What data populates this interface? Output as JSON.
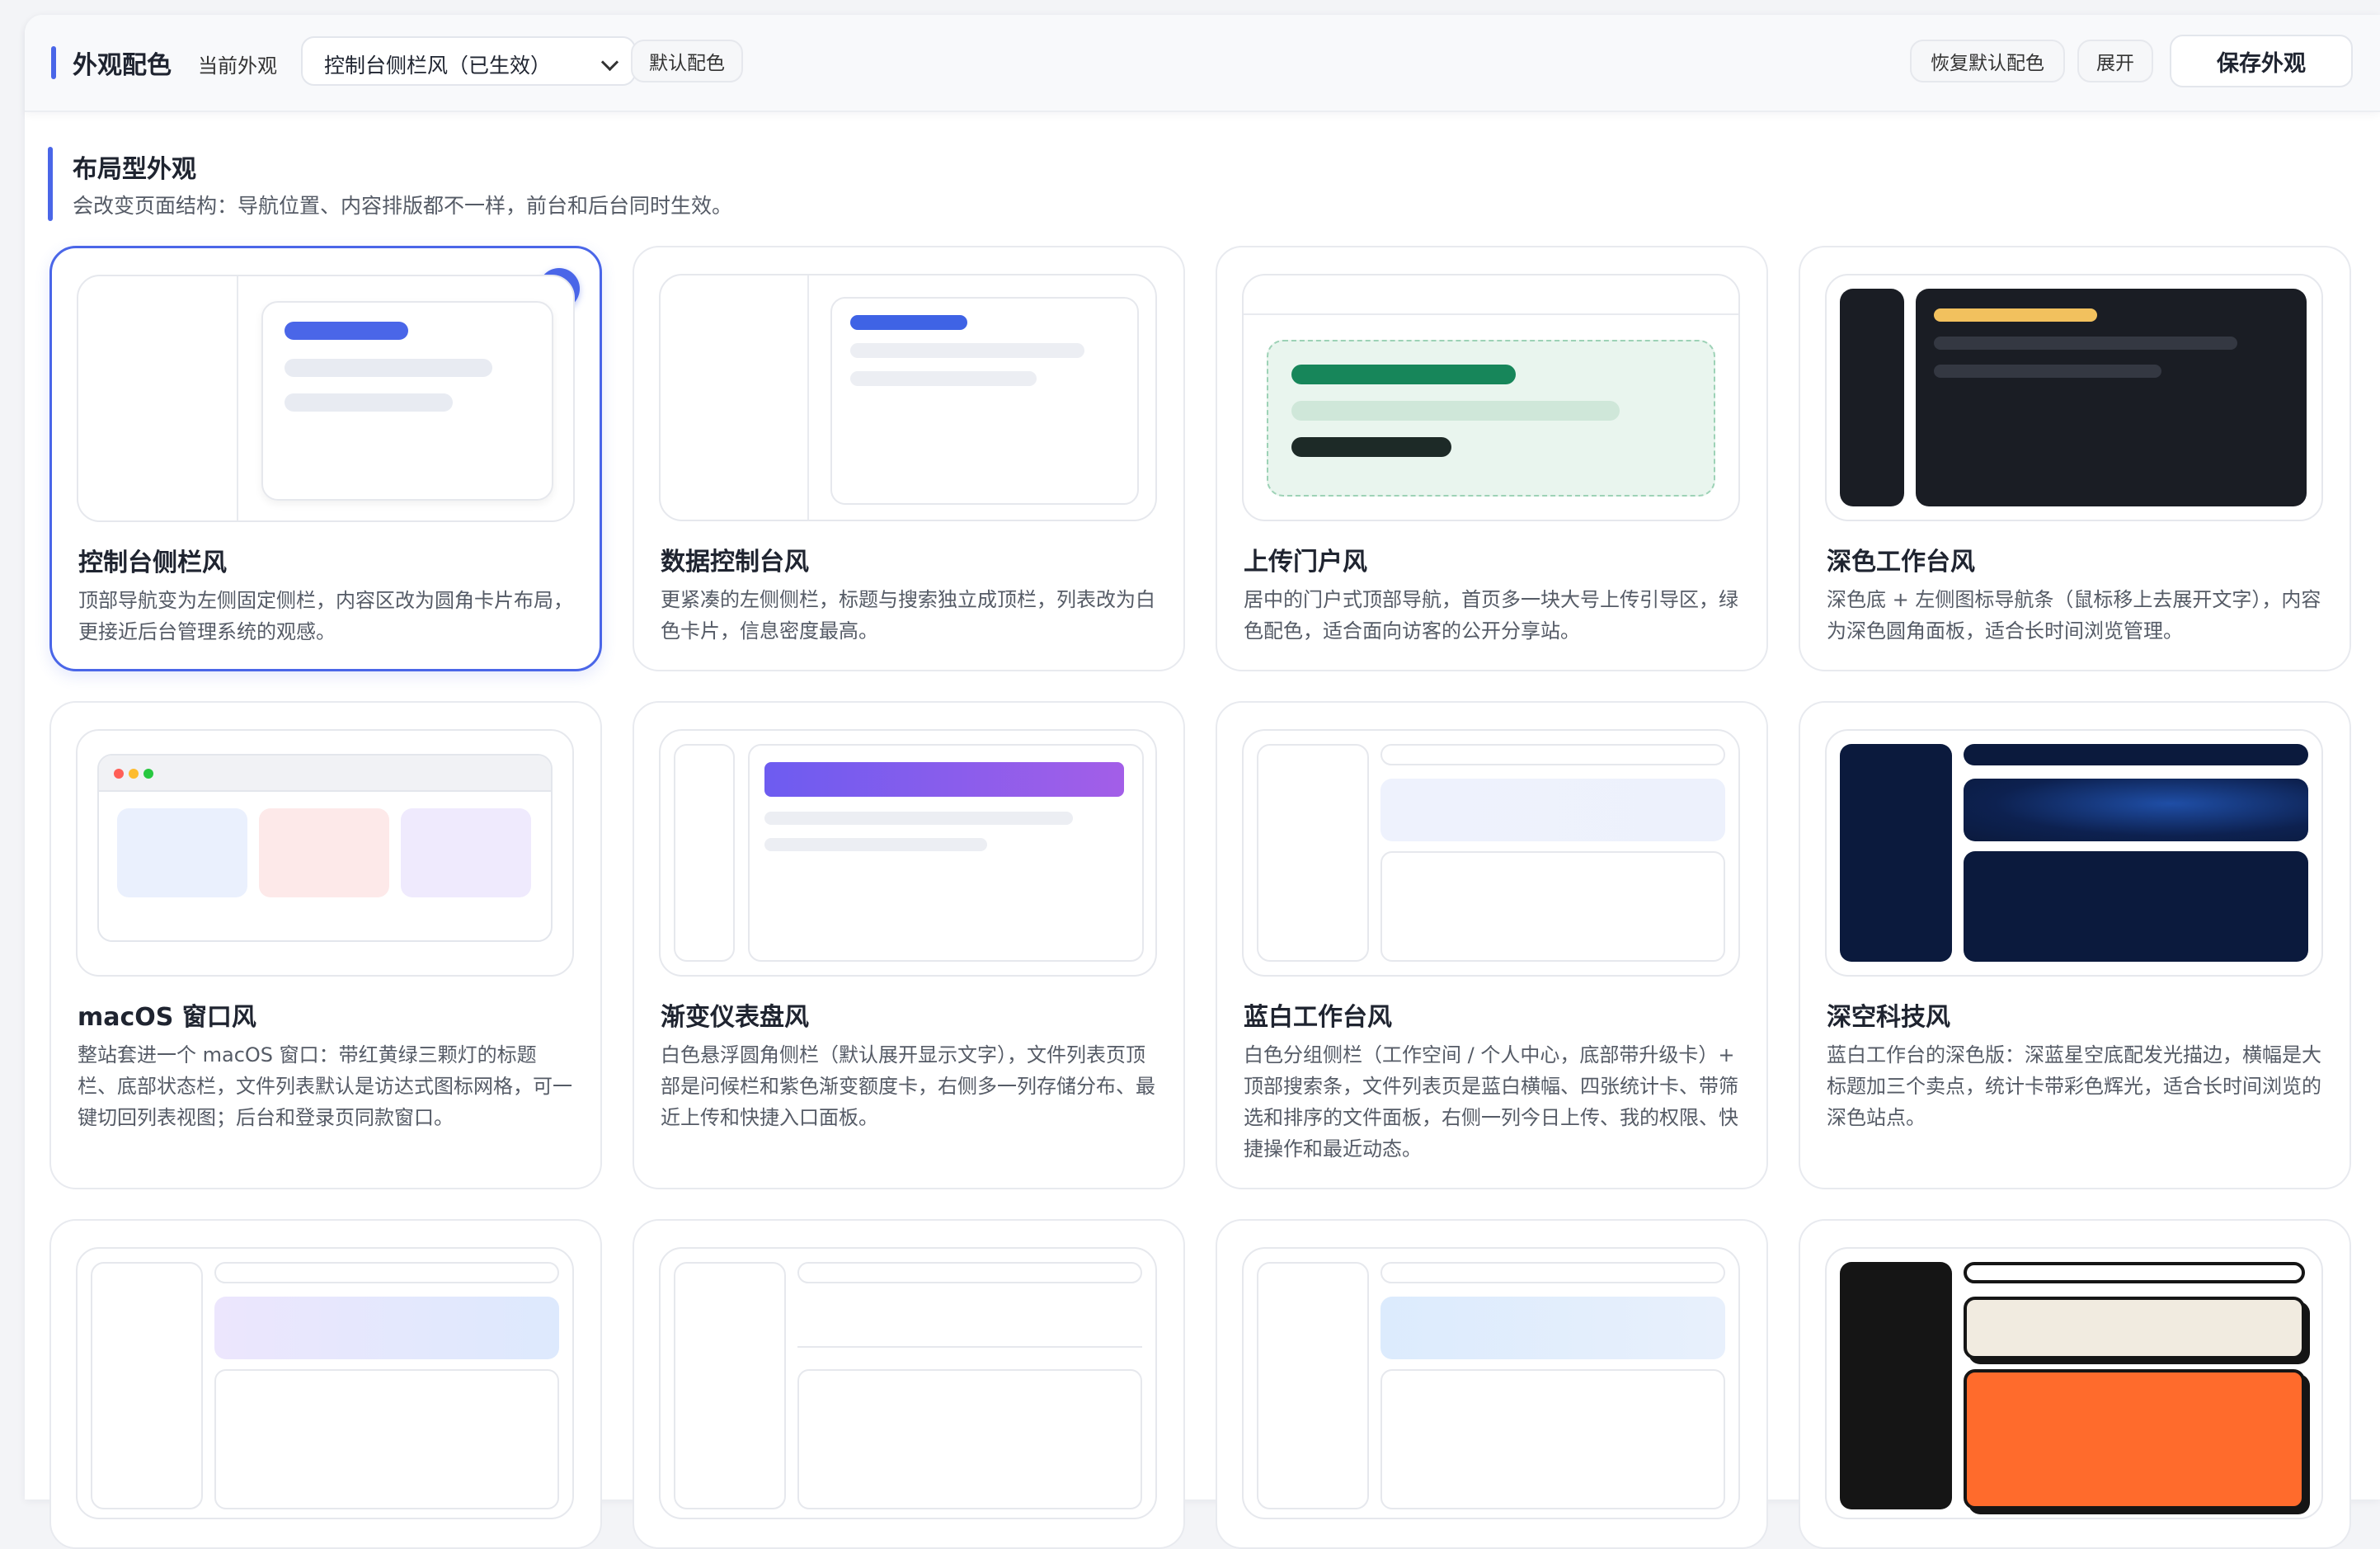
{
  "toolbar": {
    "title": "外观配色",
    "current_label": "当前外观",
    "current_value": "控制台侧栏风（已生效）",
    "default_color_label": "默认配色",
    "restore_label": "恢复默认配色",
    "expand_label": "展开",
    "save_label": "保存外观"
  },
  "section": {
    "title": "布局型外观",
    "description": "会改变页面结构：导航位置、内容排版都不一样，前台和后台同时生效。"
  },
  "cards": [
    {
      "name": "控制台侧栏风",
      "desc": "顶部导航变为左侧固定侧栏，内容区改为圆角卡片布局，更接近后台管理系统的观感。",
      "selected": true
    },
    {
      "name": "数据控制台风",
      "desc": "更紧凑的左侧侧栏，标题与搜索独立成顶栏，列表改为白色卡片，信息密度最高。"
    },
    {
      "name": "上传门户风",
      "desc": "居中的门户式顶部导航，首页多一块大号上传引导区，绿色配色，适合面向访客的公开分享站。"
    },
    {
      "name": "深色工作台风",
      "desc": "深色底 + 左侧图标导航条（鼠标移上去展开文字），内容为深色圆角面板，适合长时间浏览管理。"
    },
    {
      "name": "macOS 窗口风",
      "desc": "整站套进一个 macOS 窗口：带红黄绿三颗灯的标题栏、底部状态栏，文件列表默认是访达式图标网格，可一键切回列表视图；后台和登录页同款窗口。"
    },
    {
      "name": "渐变仪表盘风",
      "desc": "白色悬浮圆角侧栏（默认展开显示文字），文件列表页顶部是问候栏和紫色渐变额度卡，右侧多一列存储分布、最近上传和快捷入口面板。"
    },
    {
      "name": "蓝白工作台风",
      "desc": "白色分组侧栏（工作空间 / 个人中心，底部带升级卡）+ 顶部搜索条，文件列表页是蓝白横幅、四张统计卡、带筛选和排序的文件面板，右侧一列今日上传、我的权限、快捷操作和最近动态。"
    },
    {
      "name": "深空科技风",
      "desc": "蓝白工作台的深色版：深蓝星空底配发光描边，横幅是大标题加三个卖点，统计卡带彩色辉光，适合长时间浏览的深色站点。"
    }
  ],
  "colors": {
    "accent": "#4a66e8",
    "green": "#17865a",
    "dark": "#1a1d24",
    "navy": "#0b1a3d",
    "orange": "#ff6b2c"
  }
}
